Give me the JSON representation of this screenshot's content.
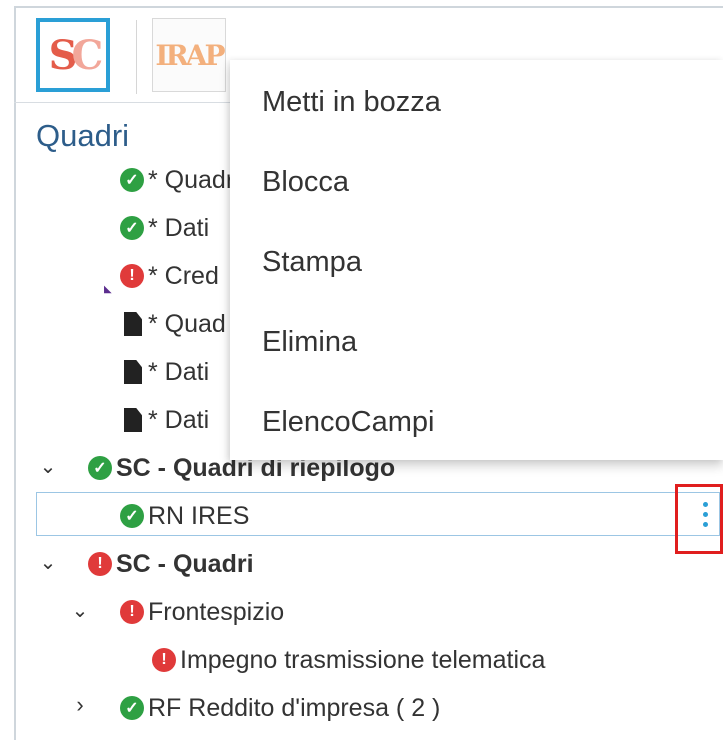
{
  "toolbar": {
    "sc_button": {
      "logo_text_1": "S",
      "logo_text_2": "C"
    },
    "irap_button": {
      "logo_text": "IRAP"
    }
  },
  "panel": {
    "title": "Quadri",
    "items": [
      {
        "status": "ok",
        "label": "* Quadr"
      },
      {
        "status": "ok",
        "label": "* Dati"
      },
      {
        "status": "error",
        "label": "* Cred"
      },
      {
        "status": "doc",
        "label": "* Quad"
      },
      {
        "status": "doc",
        "label": "* Dati"
      },
      {
        "status": "doc",
        "label": "* Dati"
      }
    ],
    "group_riepilogo": {
      "label": "SC - Quadri di riepilogo",
      "expanded": true
    },
    "rn_ires": {
      "label": "RN IRES",
      "selected": true
    },
    "group_quadri": {
      "label": "SC - Quadri",
      "expanded": true
    },
    "frontespizio": {
      "label": "Frontespizio",
      "expanded": true
    },
    "impegno": {
      "label": "Impegno trasmissione telematica"
    },
    "rf_reddito": {
      "label": "RF Reddito d'impresa ( 2 )",
      "expanded": false
    }
  },
  "context_menu": {
    "items": [
      "Metti in bozza",
      "Blocca",
      "Stampa",
      "Elimina",
      "ElencoCampi"
    ]
  },
  "icons": {
    "ok": "check-circle-icon",
    "error": "exclamation-circle-icon",
    "doc": "document-icon",
    "expand": "chevron-down-icon",
    "collapse": "chevron-right-icon",
    "more": "kebab-menu-icon"
  },
  "colors": {
    "ok": "#2ea043",
    "error": "#e03a3a",
    "accent": "#2a9fd6",
    "highlight": "#e01e1e",
    "title": "#2d5d8a"
  }
}
